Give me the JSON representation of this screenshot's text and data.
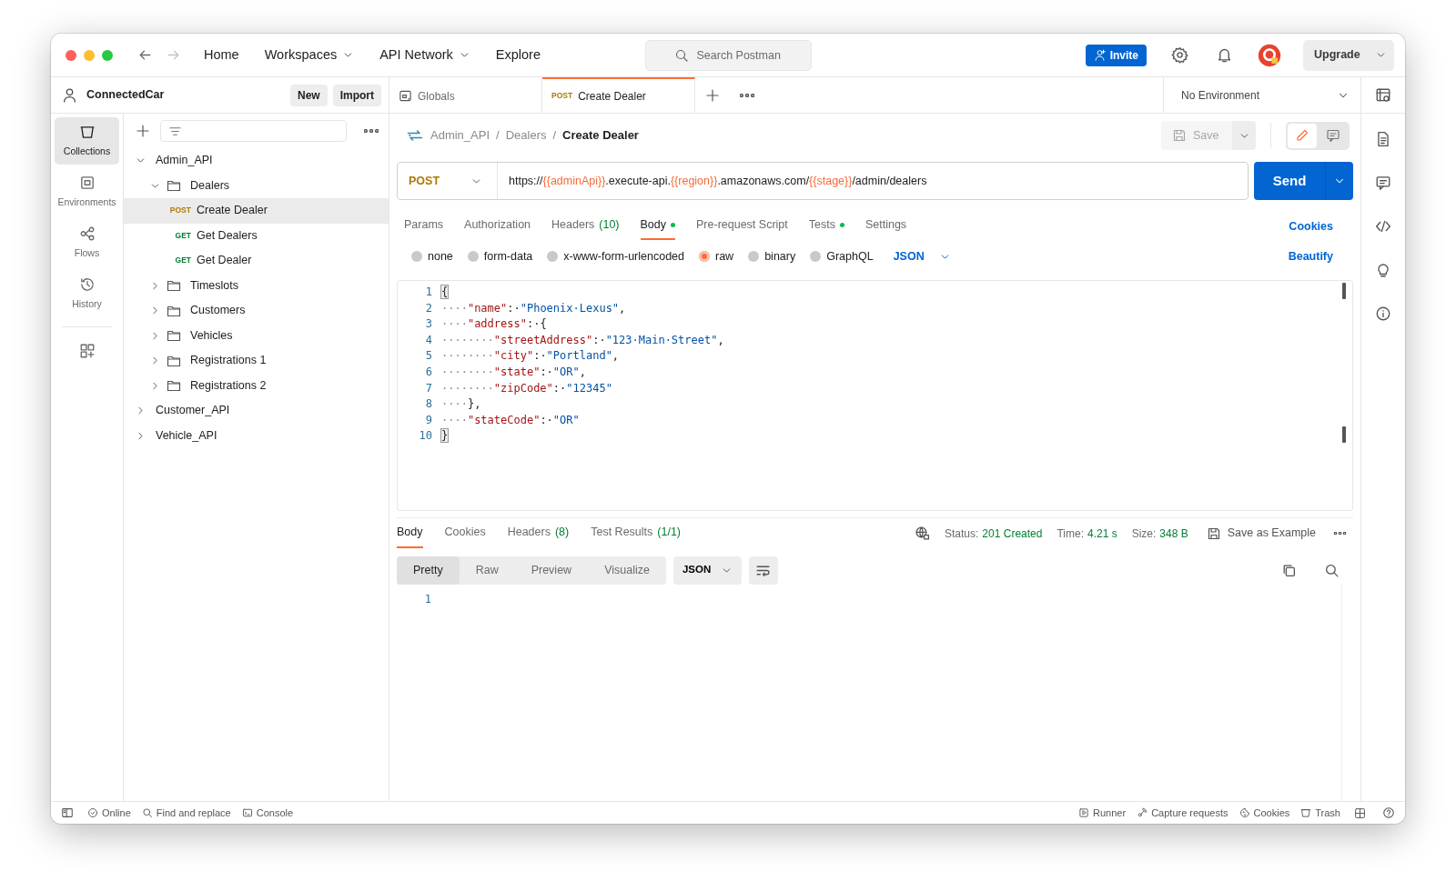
{
  "nav": {
    "back": {
      "disabled": false
    },
    "forward": {
      "disabled": true
    },
    "links": [
      {
        "label": "Home",
        "dropdown": false
      },
      {
        "label": "Workspaces",
        "dropdown": true
      },
      {
        "label": "API Network",
        "dropdown": true
      },
      {
        "label": "Explore",
        "dropdown": false
      }
    ]
  },
  "search": {
    "placeholder": "Search Postman"
  },
  "invite": "Invite",
  "upgrade": "Upgrade",
  "workspace": {
    "name": "ConnectedCar",
    "buttons": [
      "New",
      "Import"
    ]
  },
  "rail": [
    {
      "label": "Collections",
      "selected": true
    },
    {
      "label": "Environments",
      "selected": false
    },
    {
      "label": "Flows",
      "selected": false
    },
    {
      "label": "History",
      "selected": false
    }
  ],
  "tree": [
    {
      "label": "Admin_API",
      "kind": "collection",
      "expanded": true,
      "children": [
        {
          "label": "Dealers",
          "kind": "folder",
          "expanded": true,
          "children": [
            {
              "label": "Create Dealer",
              "kind": "request",
              "method": "POST",
              "color": "#ad7a03",
              "selected": true
            },
            {
              "label": "Get Dealers",
              "kind": "request",
              "method": "GET",
              "color": "#007f31",
              "selected": false
            },
            {
              "label": "Get Dealer",
              "kind": "request",
              "method": "GET",
              "color": "#007f31",
              "selected": false
            }
          ]
        },
        {
          "label": "Timeslots",
          "kind": "folder",
          "expanded": false
        },
        {
          "label": "Customers",
          "kind": "folder",
          "expanded": false
        },
        {
          "label": "Vehicles",
          "kind": "folder",
          "expanded": false
        },
        {
          "label": "Registrations 1",
          "kind": "folder",
          "expanded": false
        },
        {
          "label": "Registrations 2",
          "kind": "folder",
          "expanded": false
        }
      ]
    },
    {
      "label": "Customer_API",
      "kind": "collection",
      "expanded": false
    },
    {
      "label": "Vehicle_API",
      "kind": "collection",
      "expanded": false
    }
  ],
  "tabs": [
    {
      "label": "Globals",
      "kind": "globals",
      "selected": false
    },
    {
      "label": "Create Dealer",
      "kind": "request",
      "method": "POST",
      "color": "#ad7a03",
      "selected": true
    }
  ],
  "environment": "No Environment",
  "breadcrumb": [
    {
      "kind": "link",
      "text": "Admin_API"
    },
    {
      "kind": "separator",
      "text": "/"
    },
    {
      "kind": "link",
      "text": "Dealers"
    },
    {
      "kind": "separator",
      "text": "/"
    },
    {
      "kind": "current",
      "text": "Create Dealer"
    }
  ],
  "save": {
    "label": "Save",
    "disabled": true
  },
  "request": {
    "method": "POST",
    "color": "#ad7a03",
    "url": [
      {
        "kind": "text",
        "text": "https://"
      },
      {
        "kind": "var",
        "text": "{{adminApi}}"
      },
      {
        "kind": "text",
        "text": ".execute-api."
      },
      {
        "kind": "var",
        "text": "{{region}}"
      },
      {
        "kind": "text",
        "text": ".amazonaws.com/"
      },
      {
        "kind": "var",
        "text": "{{stage}}"
      },
      {
        "kind": "text",
        "text": "/admin/dealers"
      }
    ],
    "send": "Send"
  },
  "request_tabs": [
    {
      "label": "Params",
      "selected": false,
      "dot": false
    },
    {
      "label": "Authorization",
      "selected": false,
      "dot": false
    },
    {
      "label": "Headers",
      "count": "(10)",
      "selected": false,
      "dot": false
    },
    {
      "label": "Body",
      "selected": true,
      "dot": true
    },
    {
      "label": "Pre-request Script",
      "selected": false,
      "dot": false
    },
    {
      "label": "Tests",
      "selected": false,
      "dot": true
    },
    {
      "label": "Settings",
      "selected": false,
      "dot": false
    }
  ],
  "cookies_link": "Cookies",
  "body_types": [
    {
      "label": "none",
      "selected": false
    },
    {
      "label": "form-data",
      "selected": false
    },
    {
      "label": "x-www-form-urlencoded",
      "selected": false
    },
    {
      "label": "raw",
      "selected": true
    },
    {
      "label": "binary",
      "selected": false
    },
    {
      "label": "GraphQL",
      "selected": false
    }
  ],
  "body_format": "JSON",
  "beautify": "Beautify",
  "body_lines": [
    {
      "number": "1",
      "tokens": [
        {
          "kind": "brace",
          "text": "{"
        }
      ]
    },
    {
      "number": "2",
      "tokens": [
        {
          "kind": "ws",
          "text": "····"
        },
        {
          "kind": "key",
          "text": "\"name\""
        },
        {
          "kind": "punct",
          "text": ":·"
        },
        {
          "kind": "string",
          "text": "\"Phoenix·Lexus\""
        },
        {
          "kind": "punct",
          "text": ","
        }
      ]
    },
    {
      "number": "3",
      "tokens": [
        {
          "kind": "ws",
          "text": "····"
        },
        {
          "kind": "key",
          "text": "\"address\""
        },
        {
          "kind": "punct",
          "text": ":·{"
        }
      ]
    },
    {
      "number": "4",
      "tokens": [
        {
          "kind": "ws",
          "text": "········"
        },
        {
          "kind": "key",
          "text": "\"streetAddress\""
        },
        {
          "kind": "punct",
          "text": ":·"
        },
        {
          "kind": "string",
          "text": "\"123·Main·Street\""
        },
        {
          "kind": "punct",
          "text": ","
        }
      ]
    },
    {
      "number": "5",
      "tokens": [
        {
          "kind": "ws",
          "text": "········"
        },
        {
          "kind": "key",
          "text": "\"city\""
        },
        {
          "kind": "punct",
          "text": ":·"
        },
        {
          "kind": "string",
          "text": "\"Portland\""
        },
        {
          "kind": "punct",
          "text": ","
        }
      ]
    },
    {
      "number": "6",
      "tokens": [
        {
          "kind": "ws",
          "text": "········"
        },
        {
          "kind": "key",
          "text": "\"state\""
        },
        {
          "kind": "punct",
          "text": ":·"
        },
        {
          "kind": "string",
          "text": "\"OR\""
        },
        {
          "kind": "punct",
          "text": ","
        }
      ]
    },
    {
      "number": "7",
      "tokens": [
        {
          "kind": "ws",
          "text": "········"
        },
        {
          "kind": "key",
          "text": "\"zipCode\""
        },
        {
          "kind": "punct",
          "text": ":·"
        },
        {
          "kind": "string",
          "text": "\"12345\""
        }
      ]
    },
    {
      "number": "8",
      "tokens": [
        {
          "kind": "ws",
          "text": "····"
        },
        {
          "kind": "punct",
          "text": "},"
        }
      ]
    },
    {
      "number": "9",
      "tokens": [
        {
          "kind": "ws",
          "text": "····"
        },
        {
          "kind": "key",
          "text": "\"stateCode\""
        },
        {
          "kind": "punct",
          "text": ":·"
        },
        {
          "kind": "string",
          "text": "\"OR\""
        }
      ]
    },
    {
      "number": "10",
      "tokens": [
        {
          "kind": "brace",
          "text": "}"
        }
      ]
    }
  ],
  "response": {
    "tabs": [
      {
        "label": "Body",
        "selected": true
      },
      {
        "label": "Cookies",
        "selected": false
      },
      {
        "label": "Headers",
        "count": "(8)",
        "selected": false
      },
      {
        "label": "Test Results",
        "count": "(1/1)",
        "selected": false
      }
    ],
    "stats": [
      {
        "label": "Status:",
        "value": "201 Created"
      },
      {
        "label": "Time:",
        "value": "4.21 s"
      },
      {
        "label": "Size:",
        "value": "348 B"
      }
    ],
    "save_example": "Save as Example",
    "views": [
      {
        "label": "Pretty",
        "selected": true
      },
      {
        "label": "Raw",
        "selected": false
      },
      {
        "label": "Preview",
        "selected": false
      },
      {
        "label": "Visualize",
        "selected": false
      }
    ],
    "format": "JSON",
    "lines": [
      "1"
    ]
  },
  "status_bar": {
    "left": [
      {
        "label": "Online",
        "kind": "online"
      },
      {
        "label": "Find and replace",
        "kind": "find"
      },
      {
        "label": "Console",
        "kind": "console"
      }
    ],
    "right": [
      {
        "label": "Runner",
        "kind": "runner"
      },
      {
        "label": "Capture requests",
        "kind": "capture"
      },
      {
        "label": "Cookies",
        "kind": "cookies"
      },
      {
        "label": "Trash",
        "kind": "trash"
      }
    ]
  }
}
